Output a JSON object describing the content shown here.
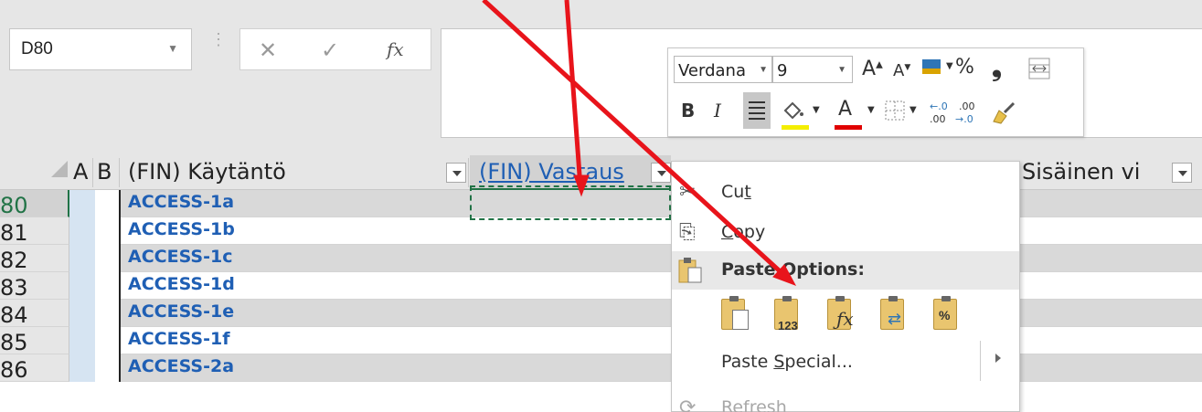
{
  "formula_bar": {
    "name_box": "D80",
    "cancel_icon": "x-icon",
    "enter_icon": "checkmark-icon",
    "function_label": "fx",
    "formula_value": ""
  },
  "mini_toolbar": {
    "font_name": "Verdana",
    "font_size": "9",
    "percent": "%",
    "comma": "❟",
    "decimal_increase": "←.0 .00",
    "decimal_decrease": ".00 →.0",
    "bold": "B",
    "italic": "I",
    "fill_color": "#f4ee00",
    "font_color": "#e00000"
  },
  "sheet": {
    "col_a": "A",
    "col_b": "B",
    "col_c": "(FIN) Käytäntö",
    "col_d": "(FIN) Vastaus",
    "col_f": "Sisäinen vi",
    "rows": [
      {
        "num": "80",
        "policy": "ACCESS-1a"
      },
      {
        "num": "81",
        "policy": "ACCESS-1b"
      },
      {
        "num": "82",
        "policy": "ACCESS-1c"
      },
      {
        "num": "83",
        "policy": "ACCESS-1d"
      },
      {
        "num": "84",
        "policy": "ACCESS-1e"
      },
      {
        "num": "85",
        "policy": "ACCESS-1f"
      },
      {
        "num": "86",
        "policy": "ACCESS-2a"
      }
    ],
    "selected_row": "80",
    "accent_color": "#217346",
    "policy_color": "#1f5fb4"
  },
  "context_menu": {
    "cut": {
      "pre": "Cu",
      "u": "t",
      "post": ""
    },
    "copy": {
      "pre": "",
      "u": "C",
      "post": "opy"
    },
    "paste_options": "Paste Options:",
    "paste_values_label": "123",
    "paste_special": {
      "pre": "Paste ",
      "u": "S",
      "post": "pecial..."
    },
    "refresh": "Refresh"
  },
  "annotation": {
    "arrow_color": "#e8141b"
  }
}
